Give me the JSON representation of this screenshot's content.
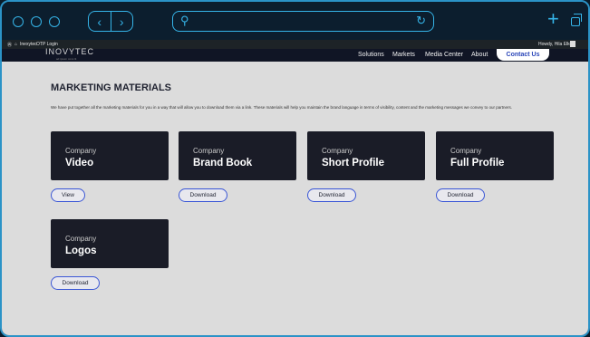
{
  "browser": {
    "url": ""
  },
  "admin_bar": {
    "site": "Inexytec",
    "item": "OTP Login",
    "greeting": "Howdy, Hila Elkon"
  },
  "nav": {
    "logo": "INOVYTEC",
    "logo_sub": "ad ipsum cons lit",
    "links": [
      "Solutions",
      "Markets",
      "Media Center",
      "About"
    ],
    "cta": "Contact Us"
  },
  "page": {
    "title": "MARKETING MATERIALS",
    "description": "We have put together all the marketing materials for you in a way that will allow you to download them via a link. These materials will help you maintain the brand language in terms of visibility, content and the marketing messages we convey to our partners.",
    "cards": [
      {
        "caption": "Company",
        "name": "Video",
        "button": "View"
      },
      {
        "caption": "Company",
        "name": "Brand Book",
        "button": "Download"
      },
      {
        "caption": "Company",
        "name": "Short Profile",
        "button": "Download"
      },
      {
        "caption": "Company",
        "name": "Full Profile",
        "button": "Download"
      },
      {
        "caption": "Company",
        "name": "Logos",
        "button": "Download"
      }
    ]
  },
  "colors": {
    "accent": "#35b4e8",
    "button_border": "#3b57d6",
    "card_bg": "#1a1c27",
    "page_bg": "#dcdcdc"
  }
}
